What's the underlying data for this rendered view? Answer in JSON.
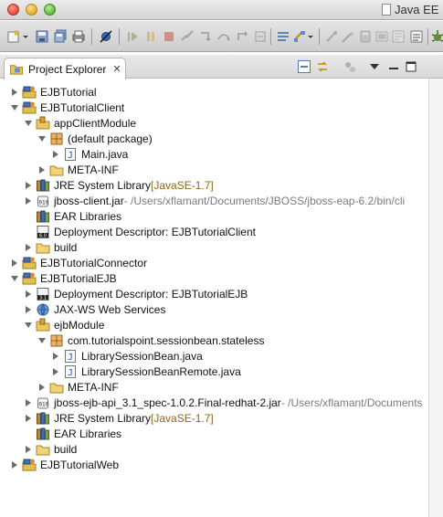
{
  "window": {
    "title": "Java EE"
  },
  "view": {
    "tab_label": "Project Explorer",
    "tab_close_glyph": "✕"
  },
  "tree": [
    {
      "label": "EJBTutorial",
      "suffix": "",
      "icon": "ejb-project-icon",
      "state": "closed"
    },
    {
      "label": "EJBTutorialClient",
      "suffix": "",
      "icon": "ejb-project-icon",
      "state": "open"
    },
    {
      "label": "appClientModule",
      "suffix": "",
      "icon": "source-folder-icon",
      "state": "open"
    },
    {
      "label": "(default package)",
      "suffix": "",
      "icon": "package-icon",
      "state": "open"
    },
    {
      "label": "Main.java",
      "suffix": "",
      "icon": "java-file-icon",
      "state": "closed"
    },
    {
      "label": "META-INF",
      "suffix": "",
      "icon": "folder-icon",
      "state": "closed"
    },
    {
      "label": "JRE System Library ",
      "suffix": "[JavaSE-1.7]",
      "icon": "library-icon",
      "state": "closed"
    },
    {
      "label": "jboss-client.jar",
      "suffix": " - /Users/xflamant/Documents/JBOSS/jboss-eap-6.2/bin/cli",
      "icon": "jar-icon",
      "state": "closed"
    },
    {
      "label": "EAR Libraries",
      "suffix": "",
      "icon": "library-icon",
      "state": "none"
    },
    {
      "label": "Deployment Descriptor: EJBTutorialClient",
      "suffix": "",
      "icon": "descriptor-6-icon",
      "state": "none"
    },
    {
      "label": "build",
      "suffix": "",
      "icon": "folder-icon",
      "state": "closed"
    },
    {
      "label": "EJBTutorialConnector",
      "suffix": "",
      "icon": "ejb-project-icon",
      "state": "closed"
    },
    {
      "label": "EJBTutorialEJB",
      "suffix": "",
      "icon": "ejb-project-icon",
      "state": "open"
    },
    {
      "label": "Deployment Descriptor: EJBTutorialEJB",
      "suffix": "",
      "icon": "descriptor-31-icon",
      "state": "closed"
    },
    {
      "label": "JAX-WS Web Services",
      "suffix": "",
      "icon": "web-services-icon",
      "state": "closed"
    },
    {
      "label": "ejbModule",
      "suffix": "",
      "icon": "source-folder-icon",
      "state": "open"
    },
    {
      "label": "com.tutorialspoint.sessionbean.stateless",
      "suffix": "",
      "icon": "package-icon",
      "state": "open"
    },
    {
      "label": "LibrarySessionBean.java",
      "suffix": "",
      "icon": "java-file-icon",
      "state": "closed"
    },
    {
      "label": "LibrarySessionBeanRemote.java",
      "suffix": "",
      "icon": "java-file-icon",
      "state": "closed"
    },
    {
      "label": "META-INF",
      "suffix": "",
      "icon": "folder-icon",
      "state": "closed"
    },
    {
      "label": "jboss-ejb-api_3.1_spec-1.0.2.Final-redhat-2.jar",
      "suffix": " - /Users/xflamant/Documents",
      "icon": "jar-icon",
      "state": "closed"
    },
    {
      "label": "JRE System Library ",
      "suffix": "[JavaSE-1.7]",
      "icon": "library-icon",
      "state": "closed"
    },
    {
      "label": "EAR Libraries",
      "suffix": "",
      "icon": "library-icon",
      "state": "none"
    },
    {
      "label": "build",
      "suffix": "",
      "icon": "folder-icon",
      "state": "closed"
    },
    {
      "label": "EJBTutorialWeb",
      "suffix": "",
      "icon": "ejb-project-icon",
      "state": "closed"
    }
  ]
}
